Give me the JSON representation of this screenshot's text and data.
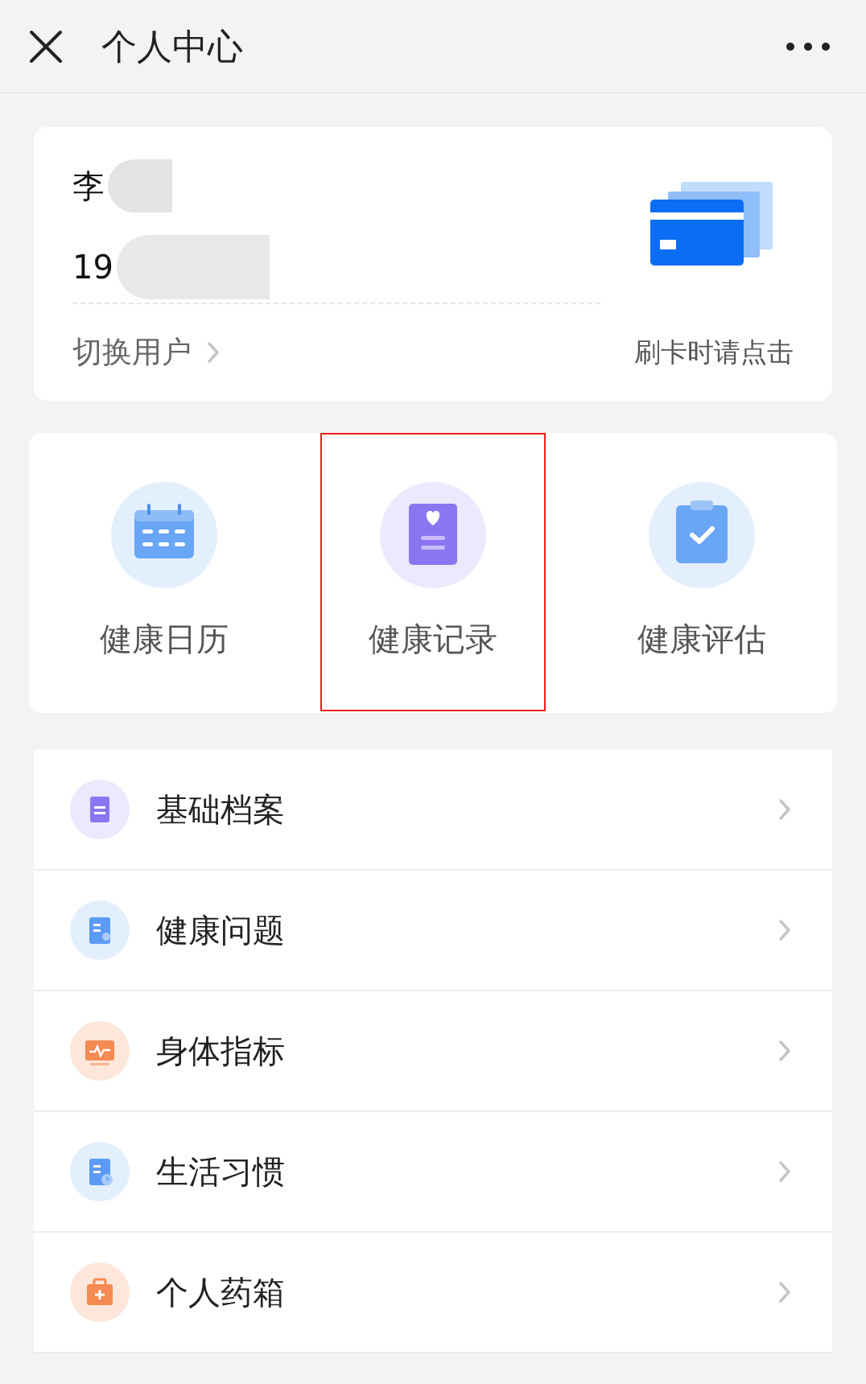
{
  "header": {
    "title": "个人中心"
  },
  "user_card": {
    "name": "李",
    "phone": "19",
    "switch_label": "切换用户",
    "card_hint": "刷卡时请点击"
  },
  "shortcuts": [
    {
      "label": "健康日历",
      "kind": "calendar",
      "selected": false
    },
    {
      "label": "健康记录",
      "kind": "record",
      "selected": true
    },
    {
      "label": "健康评估",
      "kind": "assess",
      "selected": false
    }
  ],
  "menu": [
    {
      "label": "基础档案",
      "kind": "profile"
    },
    {
      "label": "健康问题",
      "kind": "problem"
    },
    {
      "label": "身体指标",
      "kind": "vitals"
    },
    {
      "label": "生活习惯",
      "kind": "habit"
    },
    {
      "label": "个人药箱",
      "kind": "medicine"
    }
  ]
}
